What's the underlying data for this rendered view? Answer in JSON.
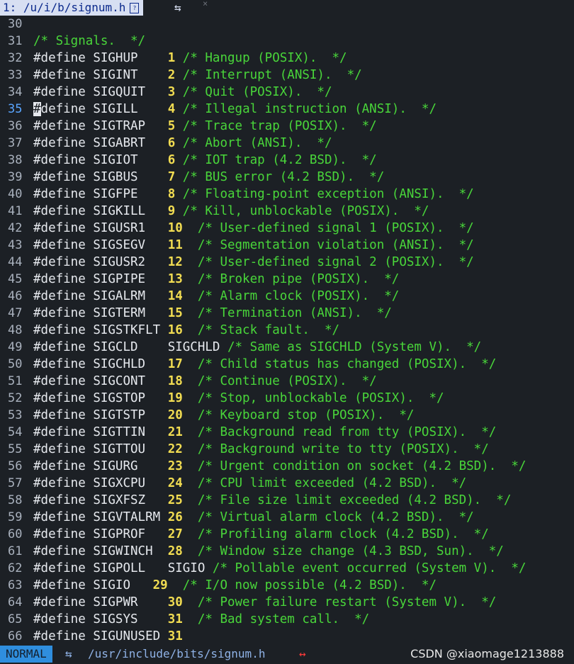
{
  "tab": {
    "index_label": "1:",
    "title": "/u/i/b/signum.h",
    "badge": "",
    "arrows": "⇆",
    "close": "×"
  },
  "lines": [
    {
      "n": "30",
      "def": "",
      "name": "",
      "val": "",
      "cm": ""
    },
    {
      "n": "31",
      "def": "",
      "name": "",
      "val": "",
      "cm": "/* Signals.  */"
    },
    {
      "n": "32",
      "def": "#define",
      "name": "SIGHUP",
      "val": "1",
      "cm": "/* Hangup (POSIX).  */"
    },
    {
      "n": "33",
      "def": "#define",
      "name": "SIGINT",
      "val": "2",
      "cm": "/* Interrupt (ANSI).  */"
    },
    {
      "n": "34",
      "def": "#define",
      "name": "SIGQUIT",
      "val": "3",
      "cm": "/* Quit (POSIX).  */"
    },
    {
      "n": "35",
      "def": "#define",
      "name": "SIGILL",
      "val": "4",
      "cm": "/* Illegal instruction (ANSI).  */"
    },
    {
      "n": "36",
      "def": "#define",
      "name": "SIGTRAP",
      "val": "5",
      "cm": "/* Trace trap (POSIX).  */"
    },
    {
      "n": "37",
      "def": "#define",
      "name": "SIGABRT",
      "val": "6",
      "cm": "/* Abort (ANSI).  */"
    },
    {
      "n": "38",
      "def": "#define",
      "name": "SIGIOT",
      "val": "6",
      "cm": "/* IOT trap (4.2 BSD).  */"
    },
    {
      "n": "39",
      "def": "#define",
      "name": "SIGBUS",
      "val": "7",
      "cm": "/* BUS error (4.2 BSD).  */"
    },
    {
      "n": "40",
      "def": "#define",
      "name": "SIGFPE",
      "val": "8",
      "cm": "/* Floating-point exception (ANSI).  */"
    },
    {
      "n": "41",
      "def": "#define",
      "name": "SIGKILL",
      "val": "9",
      "cm": "/* Kill, unblockable (POSIX).  */"
    },
    {
      "n": "42",
      "def": "#define",
      "name": "SIGUSR1",
      "val": "10",
      "cm": "/* User-defined signal 1 (POSIX).  */"
    },
    {
      "n": "43",
      "def": "#define",
      "name": "SIGSEGV",
      "val": "11",
      "cm": "/* Segmentation violation (ANSI).  */"
    },
    {
      "n": "44",
      "def": "#define",
      "name": "SIGUSR2",
      "val": "12",
      "cm": "/* User-defined signal 2 (POSIX).  */"
    },
    {
      "n": "45",
      "def": "#define",
      "name": "SIGPIPE",
      "val": "13",
      "cm": "/* Broken pipe (POSIX).  */"
    },
    {
      "n": "46",
      "def": "#define",
      "name": "SIGALRM",
      "val": "14",
      "cm": "/* Alarm clock (POSIX).  */"
    },
    {
      "n": "47",
      "def": "#define",
      "name": "SIGTERM",
      "val": "15",
      "cm": "/* Termination (ANSI).  */"
    },
    {
      "n": "48",
      "def": "#define",
      "name": "SIGSTKFLT",
      "val": "16",
      "cm": "/* Stack fault.  */"
    },
    {
      "n": "49",
      "def": "#define",
      "name": "SIGCLD",
      "val": "SIGCHLD",
      "cm": "/* Same as SIGCHLD (System V).  */"
    },
    {
      "n": "50",
      "def": "#define",
      "name": "SIGCHLD",
      "val": "17",
      "cm": "/* Child status has changed (POSIX).  */"
    },
    {
      "n": "51",
      "def": "#define",
      "name": "SIGCONT",
      "val": "18",
      "cm": "/* Continue (POSIX).  */"
    },
    {
      "n": "52",
      "def": "#define",
      "name": "SIGSTOP",
      "val": "19",
      "cm": "/* Stop, unblockable (POSIX).  */"
    },
    {
      "n": "53",
      "def": "#define",
      "name": "SIGTSTP",
      "val": "20",
      "cm": "/* Keyboard stop (POSIX).  */"
    },
    {
      "n": "54",
      "def": "#define",
      "name": "SIGTTIN",
      "val": "21",
      "cm": "/* Background read from tty (POSIX).  */"
    },
    {
      "n": "55",
      "def": "#define",
      "name": "SIGTTOU",
      "val": "22",
      "cm": "/* Background write to tty (POSIX).  */"
    },
    {
      "n": "56",
      "def": "#define",
      "name": "SIGURG",
      "val": "23",
      "cm": "/* Urgent condition on socket (4.2 BSD).  */"
    },
    {
      "n": "57",
      "def": "#define",
      "name": "SIGXCPU",
      "val": "24",
      "cm": "/* CPU limit exceeded (4.2 BSD).  */"
    },
    {
      "n": "58",
      "def": "#define",
      "name": "SIGXFSZ",
      "val": "25",
      "cm": "/* File size limit exceeded (4.2 BSD).  */"
    },
    {
      "n": "59",
      "def": "#define",
      "name": "SIGVTALRM",
      "val": "26",
      "cm": "/* Virtual alarm clock (4.2 BSD).  */"
    },
    {
      "n": "60",
      "def": "#define",
      "name": "SIGPROF",
      "val": "27",
      "cm": "/* Profiling alarm clock (4.2 BSD).  */"
    },
    {
      "n": "61",
      "def": "#define",
      "name": "SIGWINCH",
      "val": "28",
      "cm": "/* Window size change (4.3 BSD, Sun).  */"
    },
    {
      "n": "62",
      "def": "#define",
      "name": "SIGPOLL",
      "val": "SIGIO",
      "cm": "/* Pollable event occurred (System V).  */"
    },
    {
      "n": "63",
      "def": "#define",
      "name": "SIGIO",
      "val": "29",
      "cm": "/* I/O now possible (4.2 BSD).  */"
    },
    {
      "n": "64",
      "def": "#define",
      "name": "SIGPWR",
      "val": "30",
      "cm": "/* Power failure restart (System V).  */"
    },
    {
      "n": "65",
      "def": "#define",
      "name": "SIGSYS",
      "val": "31",
      "cm": "/* Bad system call.  */"
    },
    {
      "n": "66",
      "def": "#define",
      "name": "SIGUNUSED",
      "val": "31",
      "cm": ""
    }
  ],
  "cursor_line": "35",
  "status": {
    "mode": "NORMAL",
    "arrows": "⇆",
    "path": "/usr/include/bits/signum.h",
    "modified": "↔"
  },
  "watermark": "CSDN @xiaomage1213888",
  "colors": {
    "background": "#1c2025",
    "comment": "#49d63a",
    "number": "#f2dd52",
    "mode_bg": "#2f8ede"
  }
}
